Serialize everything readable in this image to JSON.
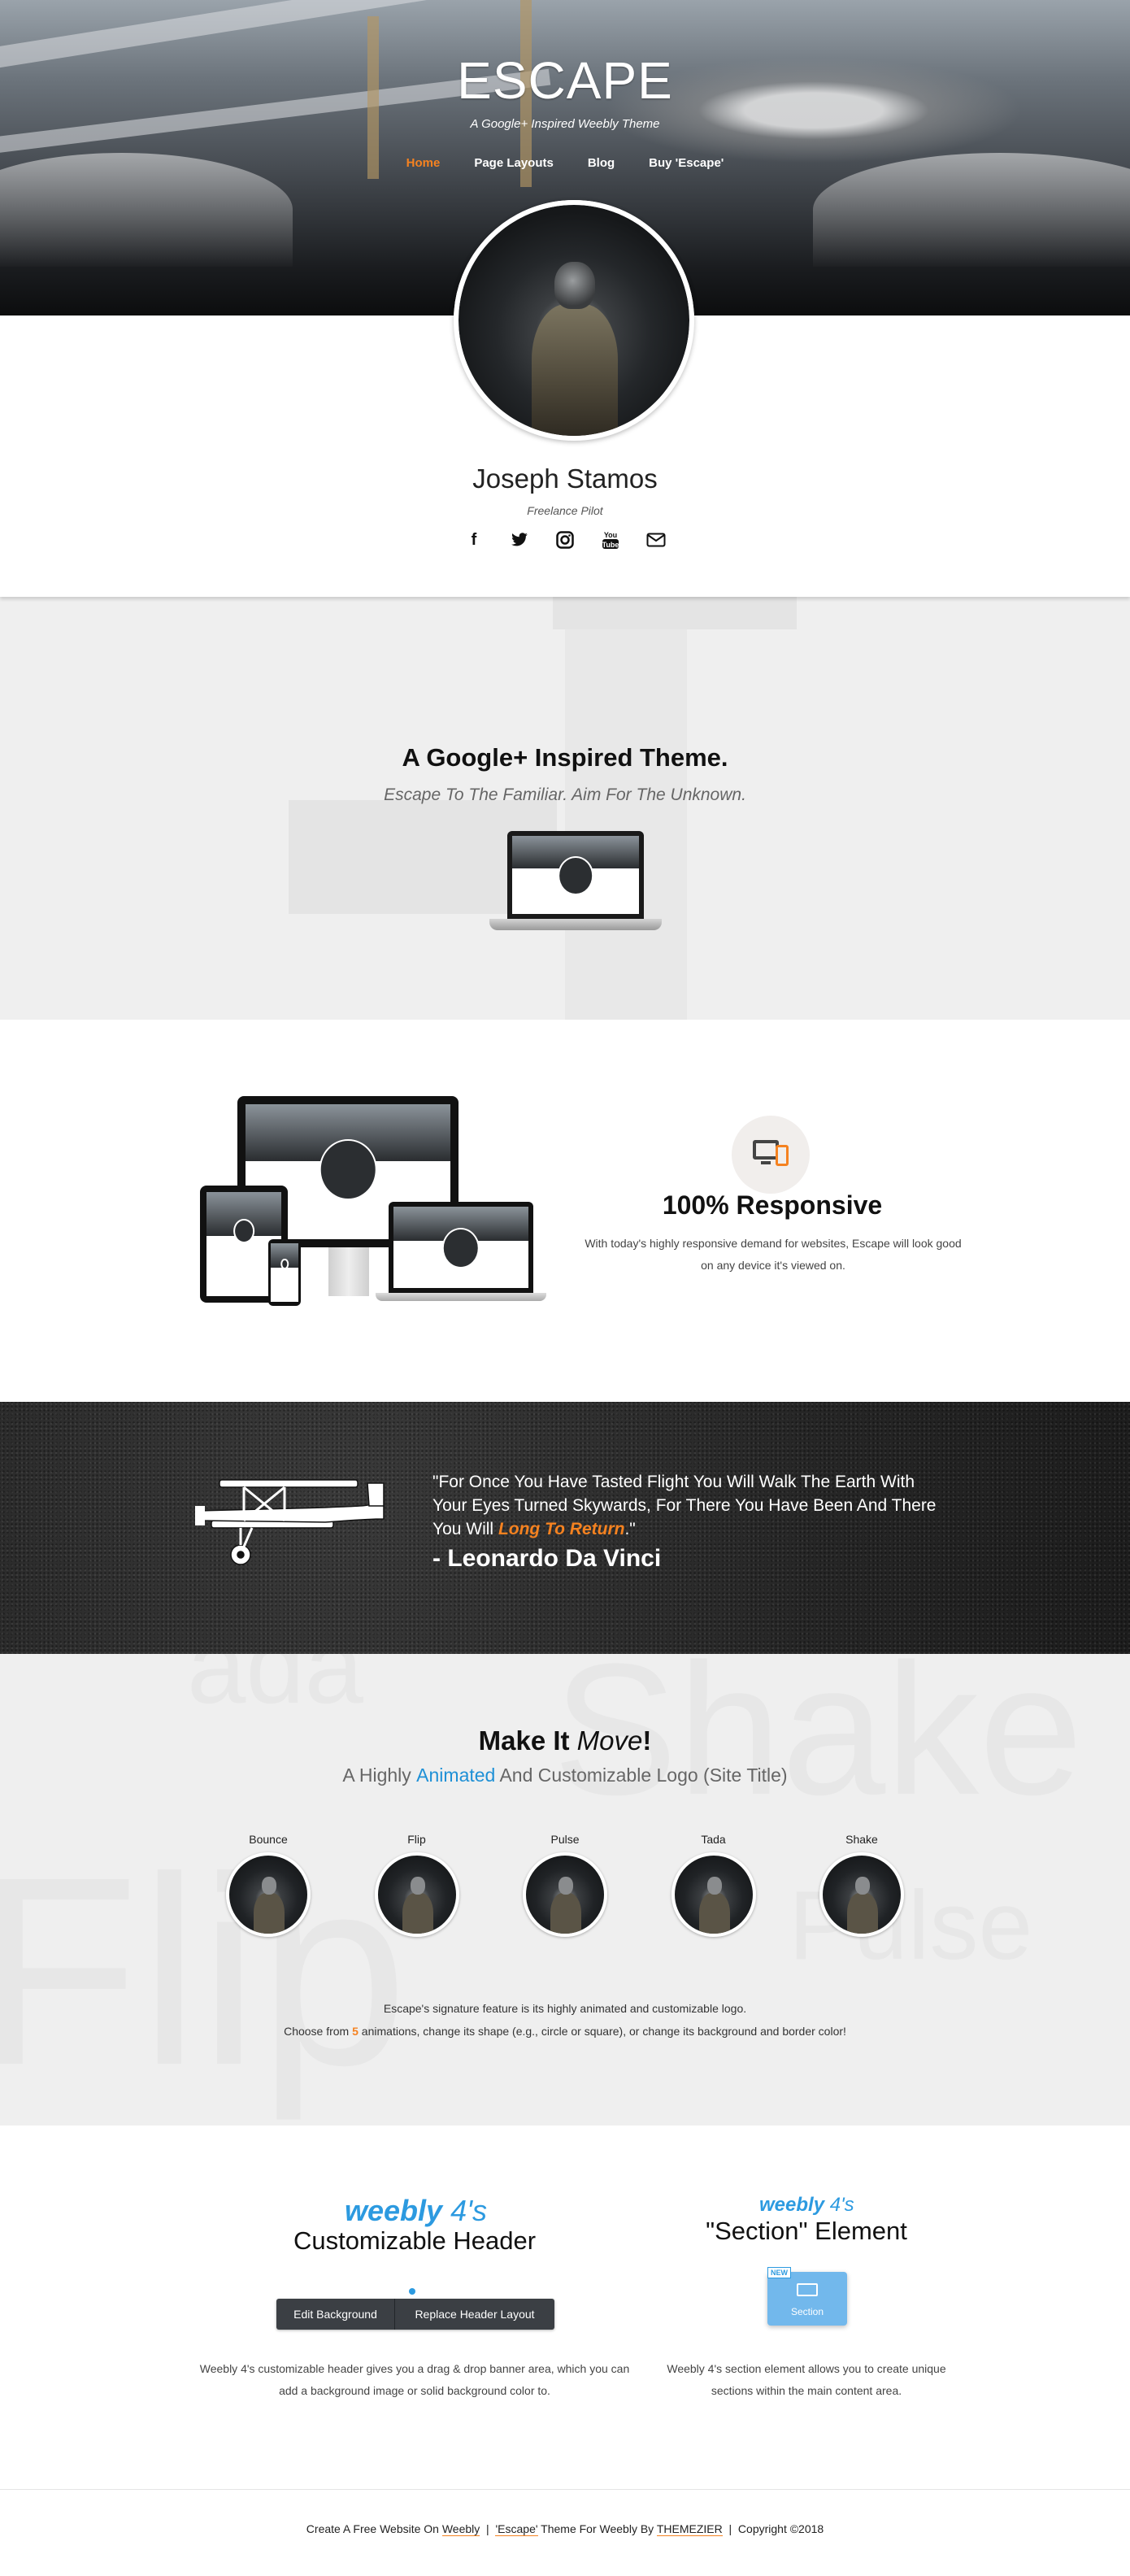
{
  "header": {
    "site_title": "ESCAPE",
    "tagline": "A Google+ Inspired Weebly Theme",
    "nav": [
      {
        "label": "Home",
        "active": true
      },
      {
        "label": "Page Layouts",
        "active": false
      },
      {
        "label": "Blog",
        "active": false
      },
      {
        "label": "Buy 'Escape'",
        "active": false
      }
    ]
  },
  "profile": {
    "name": "Joseph Stamos",
    "role": "Freelance Pilot",
    "social_icons": [
      "facebook-icon",
      "twitter-icon",
      "instagram-icon",
      "youtube-icon",
      "mail-icon"
    ],
    "youtube_glyph": "You Tube"
  },
  "intro": {
    "title": "A Google+ Inspired Theme.",
    "subtitle": "Escape To The Familiar. Aim For The Unknown."
  },
  "responsive": {
    "title": "100% Responsive",
    "text": "With today's highly responsive demand for websites, Escape will look good on any device it's viewed on."
  },
  "quote": {
    "text_start": "\"For Once You Have Tasted Flight You Will Walk The Earth With Your Eyes Turned Skywards, For There You Have Been And There You Will ",
    "highlight": "Long To Return",
    "text_end": ".\"",
    "author": "- Leonardo Da Vinci"
  },
  "animations": {
    "title_start": "Make It ",
    "title_italic": "Move",
    "title_end": "!",
    "subtitle_start": "A Highly ",
    "subtitle_highlight": "Animated",
    "subtitle_end": " And Customizable Logo (Site Title)",
    "items": [
      {
        "label": "Bounce"
      },
      {
        "label": "Flip"
      },
      {
        "label": "Pulse"
      },
      {
        "label": "Tada"
      },
      {
        "label": "Shake"
      }
    ],
    "bg_words": [
      "Shake",
      "Flip",
      "Pulse",
      "ada"
    ],
    "text1": "Escape's signature feature is its highly animated and customizable logo.",
    "text2_start": "Choose from ",
    "text2_count": "5",
    "text2_end": " animations, change its shape (e.g., circle or square), or change its background and border color!"
  },
  "weebly": {
    "logo_text": "weebly",
    "logo_suffix": "4's",
    "header_col": {
      "title": "Customizable Header",
      "btn_edit": "Edit Background",
      "btn_replace": "Replace Header Layout",
      "text": "Weebly 4's customizable header gives you a drag & drop banner area, which you can add a background image or solid background color to."
    },
    "section_col": {
      "title": "\"Section\" Element",
      "badge": "NEW",
      "element_label": "Section",
      "text": "Weebly 4's section element allows you to create unique sections within the main content area."
    }
  },
  "footer": {
    "part1": "Create A Free Website On ",
    "link1": "Weebly",
    "sep1": "  |  ",
    "link2": "'Escape'",
    "part2": " Theme For Weebly By ",
    "link3": "THEMEZIER",
    "sep2": "  |  ",
    "copyright": "Copyright ©2018"
  },
  "colors": {
    "accent": "#f58220",
    "weebly_blue": "#2c9ae0",
    "section_gray": "#efefef",
    "dark_texture": "#262626"
  }
}
